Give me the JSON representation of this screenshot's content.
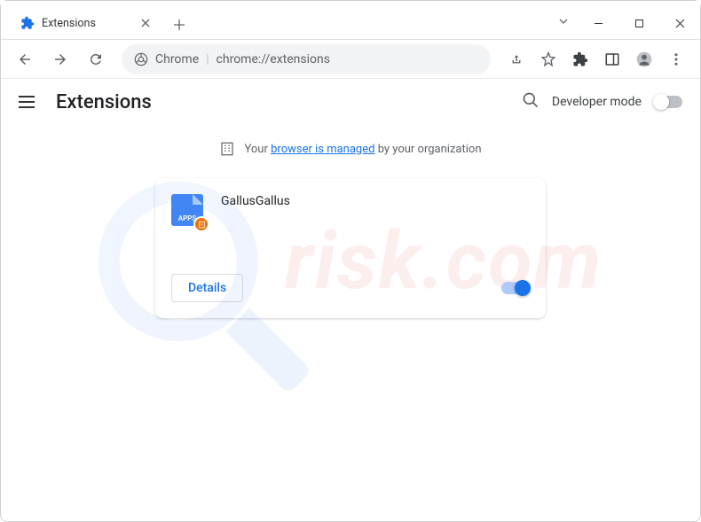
{
  "window": {
    "tab_title": "Extensions"
  },
  "omnibox": {
    "prefix": "Chrome",
    "url": "chrome://extensions"
  },
  "header": {
    "title": "Extensions",
    "developer_mode_label": "Developer mode"
  },
  "managed": {
    "prefix": "Your",
    "link": "browser is managed",
    "suffix": "by your organization"
  },
  "extension": {
    "name": "GallusGallus",
    "icon_text": "APPS",
    "details_label": "Details",
    "enabled": true
  },
  "watermark": {
    "text": "risk.com"
  }
}
